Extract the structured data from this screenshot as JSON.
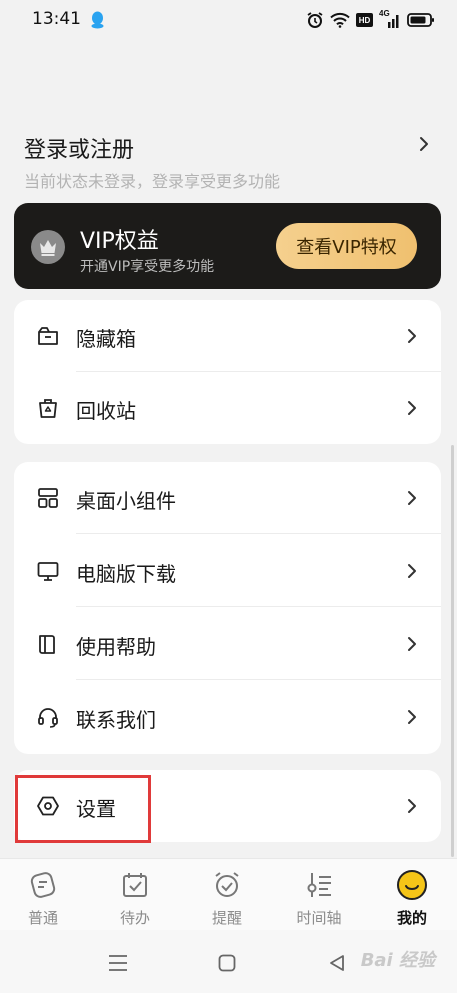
{
  "status_bar": {
    "time": "13:41",
    "hd_label": "HD",
    "network_label": "4G",
    "icons": [
      "qq-icon",
      "alarm-icon",
      "wifi-icon",
      "hd-icon",
      "signal-icon",
      "battery-icon"
    ]
  },
  "login": {
    "title": "登录或注册",
    "subtitle": "当前状态未登录，登录享受更多功能"
  },
  "vip": {
    "title": "VIP权益",
    "subtitle": "开通VIP享受更多功能",
    "button_label": "查看VIP特权",
    "colors": {
      "background": "#1c1b19",
      "button": "#f5d08e"
    }
  },
  "menu": {
    "group1": [
      {
        "label": "隐藏箱",
        "icon": "hidden-box-icon"
      },
      {
        "label": "回收站",
        "icon": "recycle-bin-icon"
      }
    ],
    "group2": [
      {
        "label": "桌面小组件",
        "icon": "widget-icon"
      },
      {
        "label": "电脑版下载",
        "icon": "monitor-icon"
      },
      {
        "label": "使用帮助",
        "icon": "book-icon"
      },
      {
        "label": "联系我们",
        "icon": "headset-icon"
      }
    ],
    "group3": [
      {
        "label": "设置",
        "icon": "settings-icon"
      }
    ]
  },
  "highlight_color": "#e03a3a",
  "bottom_nav": {
    "items": [
      {
        "label": "普通",
        "icon": "note-icon"
      },
      {
        "label": "待办",
        "icon": "todo-icon"
      },
      {
        "label": "提醒",
        "icon": "alarm-clock-icon"
      },
      {
        "label": "时间轴",
        "icon": "timeline-icon"
      },
      {
        "label": "我的",
        "icon": "smiley-icon"
      }
    ],
    "active_index": 4,
    "active_color": "#f5c518"
  },
  "system_nav": {
    "icons": [
      "menu-icon",
      "home-icon",
      "back-icon"
    ],
    "watermark": "Bai 经验"
  }
}
